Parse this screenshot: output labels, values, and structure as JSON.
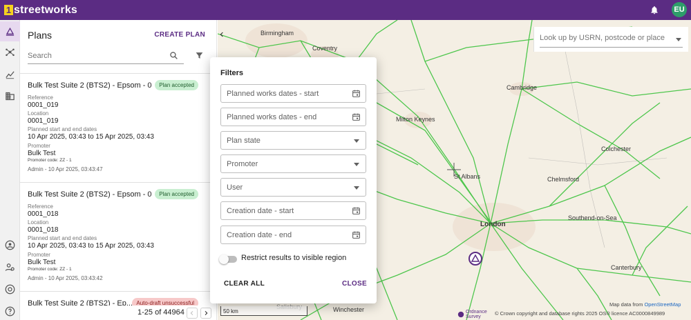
{
  "topbar": {
    "logo_mark": "1",
    "logo_text": "streetworks",
    "avatar_initials": "EU",
    "brand_color": "#5b2c83"
  },
  "rail": {
    "icons": [
      "plans-icon",
      "network-icon",
      "analytics-icon",
      "organisation-icon",
      "account-icon",
      "admin-users-icon",
      "support-icon",
      "help-icon"
    ]
  },
  "plans": {
    "title": "Plans",
    "create_label": "CREATE PLAN",
    "search_placeholder": "Search",
    "cards": [
      {
        "title": "Bulk Test Suite 2 (BTS2) - Epsom - 0...",
        "status": "Plan accepted",
        "reference_label": "Reference",
        "reference": "0001_019",
        "location_label": "Location",
        "location": "0001_019",
        "dates_label": "Planned start and end dates",
        "dates": "10 Apr 2025, 03:43 to 15 Apr 2025, 03:43",
        "promoter_label": "Promoter",
        "promoter": "Bulk Test",
        "promoter_code": "Promoter code: ZZ - 1",
        "meta": "Admin - 10 Apr 2025, 03:43:47"
      },
      {
        "title": "Bulk Test Suite 2 (BTS2) - Epsom - 0...",
        "status": "Plan accepted",
        "reference_label": "Reference",
        "reference": "0001_018",
        "location_label": "Location",
        "location": "0001_018",
        "dates_label": "Planned start and end dates",
        "dates": "10 Apr 2025, 03:43 to 15 Apr 2025, 03:43",
        "promoter_label": "Promoter",
        "promoter": "Bulk Test",
        "promoter_code": "Promoter code: ZZ - 1",
        "meta": "Admin - 10 Apr 2025, 03:43:42"
      },
      {
        "title": "Bulk Test Suite 2 (BTS2) - Ep...",
        "status": "Auto-draft unsuccessful"
      }
    ],
    "pager": "1-25 of 44964"
  },
  "map": {
    "lookup_placeholder": "Look up by USRN, postcode or place",
    "places": [
      "Birmingham",
      "Coventry",
      "Cambridge",
      "Milton Keynes",
      "Colchester",
      "St Albans",
      "Chelmsford",
      "London",
      "Southend-on-Sea",
      "Canterbury",
      "Winchester",
      "Salisbury"
    ],
    "scale": "50 km",
    "map_data": "Map data from",
    "map_data_link": "OpenStreetMap",
    "os_label": "Ordnance Survey",
    "attribution": "© Crown copyright and database rights 2025 OS® licence AC0000849989"
  },
  "filters": {
    "title": "Filters",
    "fields": [
      {
        "label": "Planned works dates - start",
        "kind": "date"
      },
      {
        "label": "Planned works dates - end",
        "kind": "date"
      },
      {
        "label": "Plan state",
        "kind": "select"
      },
      {
        "label": "Promoter",
        "kind": "select"
      },
      {
        "label": "User",
        "kind": "select"
      },
      {
        "label": "Creation date - start",
        "kind": "date"
      },
      {
        "label": "Creation date - end",
        "kind": "date"
      }
    ],
    "toggle_label": "Restrict results to visible region",
    "clear_label": "CLEAR ALL",
    "close_label": "CLOSE"
  }
}
